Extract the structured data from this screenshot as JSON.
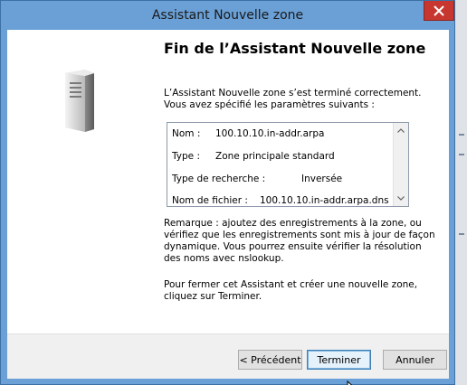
{
  "window": {
    "title": "Assistant Nouvelle zone"
  },
  "wizard": {
    "heading": "Fin de l’Assistant Nouvelle zone",
    "intro": "L’Assistant Nouvelle zone s’est terminé correctement. Vous avez spécifié les paramètres suivants :",
    "summary": [
      {
        "label": "Nom :",
        "value": "100.10.10.in-addr.arpa"
      },
      {
        "label": "Type :",
        "value": "Zone principale standard"
      },
      {
        "label": "Type de recherche :",
        "value": "Inversée"
      },
      {
        "label": "Nom de fichier :",
        "value": "100.10.10.in-addr.arpa.dns"
      }
    ],
    "remark": "Remarque : ajoutez des enregistrements à la zone, ou vérifiez que les enregistrements sont mis à jour de façon dynamique. Vous pourrez ensuite vérifier la résolution des noms avec nslookup.",
    "closing": "Pour fermer cet Assistant et créer une nouvelle zone, cliquez sur Terminer."
  },
  "buttons": {
    "back": "< Précédent",
    "finish": "Terminer",
    "cancel": "Annuler"
  },
  "icons": {
    "close": "close-icon",
    "server": "server-icon",
    "scroll_up": "scroll-up-arrow-icon",
    "scroll_down": "scroll-down-arrow-icon",
    "cursor": "mouse-pointer-icon"
  },
  "colors": {
    "titlebar": "#6aa0d6",
    "close_button": "#c7372f",
    "default_button_border": "#3c7fb1"
  }
}
